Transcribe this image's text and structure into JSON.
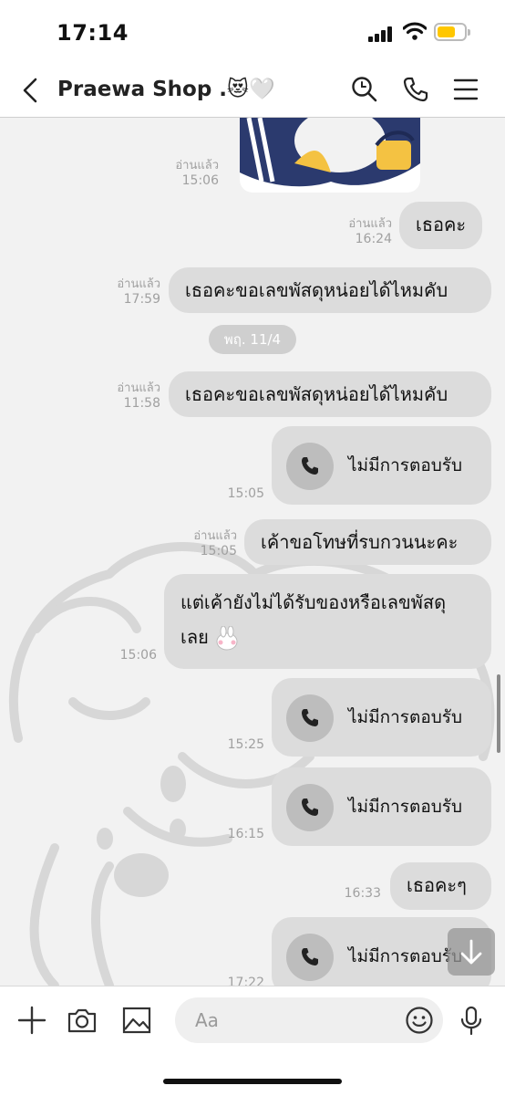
{
  "status_bar": {
    "time": "17:14"
  },
  "header": {
    "title": "Praewa Shop .😻🤍"
  },
  "messages": [
    {
      "type": "sticker",
      "read": "อ่านแล้ว",
      "time": "15:06"
    },
    {
      "type": "text",
      "text": "เธอคะ",
      "read": "อ่านแล้ว",
      "time": "16:24"
    },
    {
      "type": "text",
      "text": "เธอคะขอเลขพัสดุหน่อยได้ไหมคับ",
      "read": "อ่านแล้ว",
      "time": "17:59"
    },
    {
      "type": "text",
      "text": "เธอคะขอเลขพัสดุหน่อยได้ไหมคับ",
      "read": "อ่านแล้ว",
      "time": "11:58"
    },
    {
      "type": "call",
      "label": "ไม่มีการตอบรับ",
      "time": "15:05"
    },
    {
      "type": "text",
      "text": "เค้าขอโทษที่รบกวนนะคะ",
      "read": "อ่านแล้ว",
      "time": "15:05"
    },
    {
      "type": "text",
      "lines": [
        "แต่เค้ายังไม่ได้รับของหรือเลขพัสดุ",
        "เลย"
      ],
      "time": "15:06"
    },
    {
      "type": "call",
      "label": "ไม่มีการตอบรับ",
      "time": "15:25"
    },
    {
      "type": "call",
      "label": "ไม่มีการตอบรับ",
      "time": "16:15"
    },
    {
      "type": "text",
      "text": "เธอคะๆ",
      "time": "16:33"
    },
    {
      "type": "call",
      "label": "ไม่มีการตอบรับ",
      "time": "17:22"
    }
  ],
  "date_separator": "พฤ. 11/4",
  "input": {
    "placeholder": "Aa"
  },
  "colors": {
    "bubble": "#dcdcdc",
    "background": "#f2f2f2",
    "battery": "#ffc700"
  },
  "icons": [
    "back-icon",
    "search-icon",
    "phone-icon",
    "menu-icon",
    "plus-icon",
    "camera-icon",
    "image-icon",
    "emoji-icon",
    "mic-icon",
    "arrow-down-icon"
  ]
}
